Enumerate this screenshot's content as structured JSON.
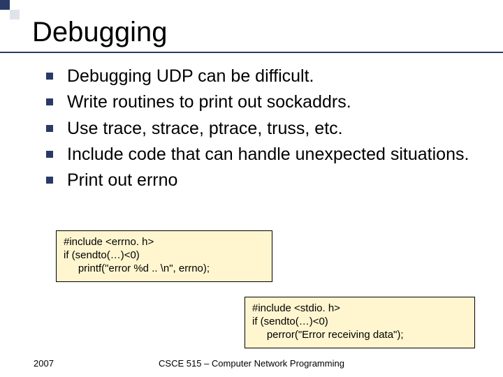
{
  "title": "Debugging",
  "bullets": {
    "items": [
      "Debugging UDP can be difficult.",
      "Write routines to print out sockaddrs.",
      "Use trace, strace, ptrace, truss, etc.",
      "Include code that can handle unexpected situations.",
      "Print out errno"
    ]
  },
  "codebox1": {
    "l1": "#include <errno. h>",
    "l2": "if (sendto(…)<0)",
    "l3": "     printf(\"error %d .. \\n\", errno);"
  },
  "codebox2": {
    "l1": "#include <stdio. h>",
    "l2": "if (sendto(…)<0)",
    "l3": "     perror(\"Error receiving data\");"
  },
  "footer": {
    "year": "2007",
    "course": "CSCE 515 – Computer Network Programming"
  }
}
